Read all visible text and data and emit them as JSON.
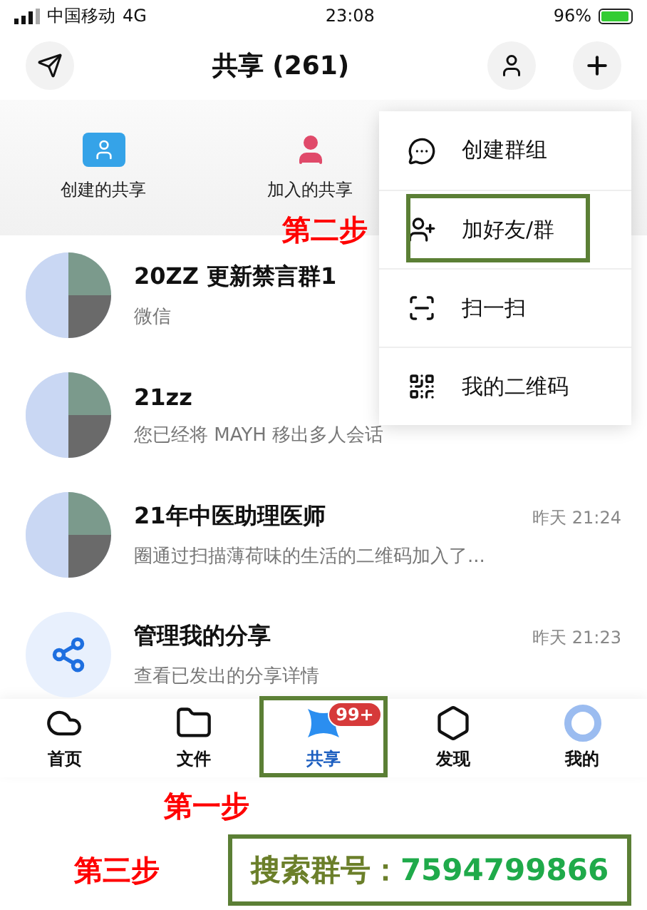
{
  "status_bar": {
    "carrier": "中国移动",
    "network": "4G",
    "time": "23:08",
    "battery": "96%"
  },
  "header": {
    "title": "共享 (261)"
  },
  "shortcuts": [
    {
      "label": "创建的共享",
      "kind": "created"
    },
    {
      "label": "加入的共享",
      "kind": "joined"
    }
  ],
  "menu": {
    "items": [
      {
        "label": "创建群组",
        "kind": "chat",
        "highlighted": false
      },
      {
        "label": "加好友/群",
        "kind": "add-user",
        "highlighted": true
      },
      {
        "label": "扫一扫",
        "kind": "scan",
        "highlighted": false
      },
      {
        "label": "我的二维码",
        "kind": "qr",
        "highlighted": false
      }
    ]
  },
  "conversations": [
    {
      "name": "20ZZ 更新禁言群1",
      "preview": "微信",
      "kind": "group"
    },
    {
      "name": "21zz",
      "preview": "您已经将 MAYH 移出多人会话",
      "kind": "group"
    },
    {
      "name": "21年中医助理医师",
      "preview": "圈通过扫描薄荷味的生活的二维码加入了...",
      "time": "昨天 21:24",
      "kind": "group"
    },
    {
      "name": "管理我的分享",
      "preview": "查看已发出的分享详情",
      "time": "昨天 21:23",
      "kind": "share"
    }
  ],
  "tabs": [
    {
      "label": "首页",
      "kind": "home",
      "selected": false
    },
    {
      "label": "文件",
      "kind": "files",
      "selected": false
    },
    {
      "label": "共享",
      "kind": "share",
      "selected": true,
      "badge": "99+",
      "highlighted": true
    },
    {
      "label": "发现",
      "kind": "discover",
      "selected": false
    },
    {
      "label": "我的",
      "kind": "me",
      "selected": false
    }
  ],
  "annotations": {
    "step_one": "第一步",
    "step_two": "第二步",
    "step_three": "第三步",
    "search_label": "搜索群号：",
    "group_number": "7594799866"
  }
}
